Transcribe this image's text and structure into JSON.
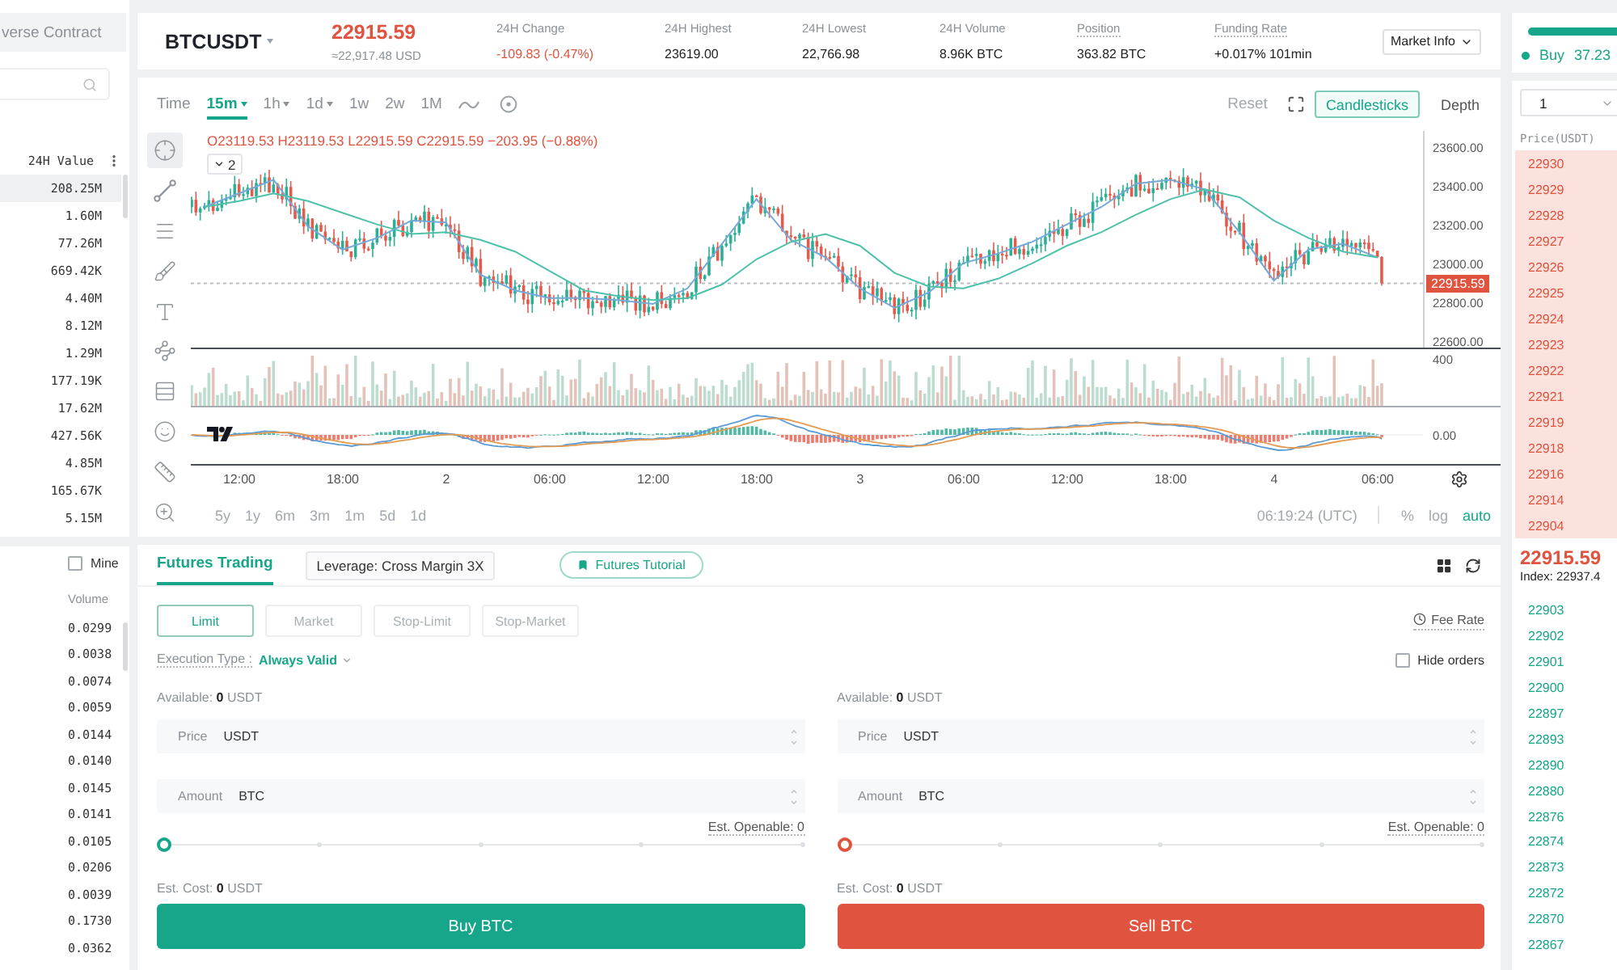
{
  "market_list": {
    "tab": "verse Contract",
    "column_header": "24H Value",
    "rows": [
      {
        "value": "208.25M",
        "selected": true
      },
      {
        "value": "1.60M",
        "selected": false
      },
      {
        "value": "77.26M",
        "selected": false
      },
      {
        "value": "669.42K",
        "selected": false
      },
      {
        "value": "4.40M",
        "selected": false
      },
      {
        "value": "8.12M",
        "selected": false
      },
      {
        "value": "1.29M",
        "selected": false
      },
      {
        "value": "177.19K",
        "selected": false
      },
      {
        "value": "17.62M",
        "selected": false
      },
      {
        "value": "427.56K",
        "selected": false
      },
      {
        "value": "4.85M",
        "selected": false
      },
      {
        "value": "165.67K",
        "selected": false
      },
      {
        "value": "5.15M",
        "selected": false
      }
    ]
  },
  "trade_history": {
    "mine": {
      "label": "Mine",
      "checked": false
    },
    "column_header": "Volume",
    "rows": [
      "0.0299",
      "0.0038",
      "0.0074",
      "0.0059",
      "0.0144",
      "0.0140",
      "0.0145",
      "0.0141",
      "0.0105",
      "0.0206",
      "0.0039",
      "0.1730",
      "0.0362"
    ]
  },
  "ticker": {
    "symbol": "BTCUSDT",
    "price": "22915.59",
    "price_usd": "≈22,917.48 USD",
    "stats": [
      {
        "label": "24H Change",
        "value": "-109.83 (-0.47%)",
        "negative": true,
        "underlined": false
      },
      {
        "label": "24H Highest",
        "value": "23619.00",
        "negative": false,
        "underlined": false
      },
      {
        "label": "24H Lowest",
        "value": "22,766.98",
        "negative": false,
        "underlined": false
      },
      {
        "label": "24H Volume",
        "value": "8.96K BTC",
        "negative": false,
        "underlined": false
      },
      {
        "label": "Position",
        "value": "363.82 BTC",
        "negative": false,
        "underlined": true
      },
      {
        "label": "Funding Rate",
        "value": "+0.017% 101min",
        "negative": false,
        "underlined": true
      }
    ],
    "market_info_button": "Market Info"
  },
  "chart": {
    "intervals": [
      {
        "label": "Time",
        "selected": false,
        "dropdown": false
      },
      {
        "label": "15m",
        "selected": true,
        "dropdown": true
      },
      {
        "label": "1h",
        "selected": false,
        "dropdown": true
      },
      {
        "label": "1d",
        "selected": false,
        "dropdown": true
      },
      {
        "label": "1w",
        "selected": false,
        "dropdown": false
      },
      {
        "label": "2w",
        "selected": false,
        "dropdown": false
      },
      {
        "label": "1M",
        "selected": false,
        "dropdown": false
      }
    ],
    "reset_button": "Reset",
    "views": [
      {
        "label": "Candlesticks",
        "selected": true
      },
      {
        "label": "Depth",
        "selected": false
      }
    ],
    "drawing_tools": [
      {
        "selected": true
      },
      {
        "selected": false
      },
      {
        "selected": false
      },
      {
        "selected": false
      },
      {
        "selected": false
      },
      {
        "selected": false
      },
      {
        "selected": false
      },
      {
        "selected": false
      },
      {
        "selected": false
      },
      {
        "selected": false
      }
    ],
    "legend": "O23119.53 H23119.53 L22915.59 C22915.59 −203.95 (−0.88%)",
    "indicator_toggle": "2",
    "chart_data": {
      "type": "line",
      "categories": [
        null,
        null,
        null,
        null,
        null,
        null,
        null,
        null,
        null,
        null,
        null,
        null,
        null,
        null,
        null,
        null,
        null,
        null,
        null,
        null,
        null,
        null,
        null,
        null,
        null,
        null,
        null,
        null,
        null,
        null,
        null,
        null,
        null,
        null,
        null
      ],
      "series": [
        {
          "color": "#74a9d8",
          "values": [
            23300,
            23370,
            23440,
            23200,
            23080,
            23140,
            23230,
            23220,
            22950,
            22870,
            22830,
            22830,
            22820,
            22800,
            22880,
            23110,
            23340,
            23130,
            23040,
            22880,
            22780,
            22860,
            23010,
            23060,
            23120,
            23210,
            23300,
            23420,
            23440,
            23390,
            23170,
            22920,
            23080,
            23110,
            23040
          ]
        },
        {
          "color": "#4fc1ab",
          "values": [
            23300,
            23330,
            23370,
            23330,
            23270,
            23210,
            23160,
            23170,
            23130,
            23070,
            22970,
            22870,
            22840,
            22820,
            22830,
            22900,
            23030,
            23120,
            23160,
            23100,
            22960,
            22890,
            22880,
            22930,
            23010,
            23100,
            23170,
            23260,
            23340,
            23390,
            23350,
            23230,
            23140,
            23070,
            23040
          ]
        }
      ],
      "ylim": [
        22575,
        23692
      ],
      "yticks": [
        {
          "value": 23600,
          "label": "23600.00"
        },
        {
          "value": 23400,
          "label": "23400.00"
        },
        {
          "value": 23200,
          "label": "23200.00"
        },
        {
          "value": 23000,
          "label": "23000.00"
        },
        {
          "value": 22800,
          "label": "22800.00"
        },
        {
          "value": 22600,
          "label": "22600.00"
        }
      ]
    },
    "last_price": "22915.59",
    "volume_axis": "400",
    "macd_axis": "0.00",
    "time_axis": [
      "12:00",
      "18:00",
      "2",
      "06:00",
      "12:00",
      "18:00",
      "3",
      "06:00",
      "12:00",
      "18:00",
      "4",
      "06:00"
    ],
    "ranges": [
      "5y",
      "1y",
      "6m",
      "3m",
      "1m",
      "5d",
      "1d"
    ],
    "clock": "06:19:24 (UTC)",
    "scale_options": [
      {
        "label": "%",
        "selected": false
      },
      {
        "label": "log",
        "selected": false
      },
      {
        "label": "auto",
        "selected": true
      }
    ]
  },
  "trading": {
    "tabs": [
      {
        "label": "Futures Trading",
        "selected": true
      }
    ],
    "leverage_button": "Leverage: Cross Margin 3X",
    "tutorial_button": "Futures Tutorial",
    "order_types": [
      {
        "label": "Limit",
        "selected": true
      },
      {
        "label": "Market",
        "selected": false
      },
      {
        "label": "Stop-Limit",
        "selected": false
      },
      {
        "label": "Stop-Market",
        "selected": false
      }
    ],
    "fee_rate": "Fee Rate",
    "execution_type": {
      "label": "Execution Type :",
      "value": "Always Valid"
    },
    "hide_orders": {
      "label": "Hide orders",
      "checked": false
    },
    "sides": [
      {
        "kind": "buy",
        "available": "Available: **0** USDT",
        "price_field": {
          "label": "Price",
          "unit": "USDT"
        },
        "amount_field": {
          "label": "Amount",
          "unit": "BTC"
        },
        "est_openable": "Est. Openable: 0",
        "slider": {
          "level": 0
        },
        "est_cost": "Est. Cost: **0** USDT",
        "button": "Buy BTC"
      },
      {
        "kind": "sell",
        "available": "Available: **0** USDT",
        "price_field": {
          "label": "Price",
          "unit": "USDT"
        },
        "amount_field": {
          "label": "Amount",
          "unit": "BTC"
        },
        "est_openable": "Est. Openable: 0",
        "slider": {
          "level": 0
        },
        "est_cost": "Est. Cost: **0** USDT",
        "button": "Sell BTC"
      }
    ]
  },
  "order_book": {
    "buy_ratio": {
      "label": "Buy",
      "value": "37.23"
    },
    "precision": "1",
    "column_header": "Price(USDT)",
    "asks": [
      "22930",
      "22929",
      "22928",
      "22927",
      "22926",
      "22925",
      "22924",
      "22923",
      "22922",
      "22921",
      "22919",
      "22918",
      "22916",
      "22914",
      "22904"
    ],
    "last_price": "22915.59",
    "index": "Index: 22937.4",
    "bids": [
      "22903",
      "22902",
      "22901",
      "22900",
      "22897",
      "22893",
      "22890",
      "22880",
      "22876",
      "22874",
      "22873",
      "22872",
      "22870",
      "22867"
    ]
  }
}
